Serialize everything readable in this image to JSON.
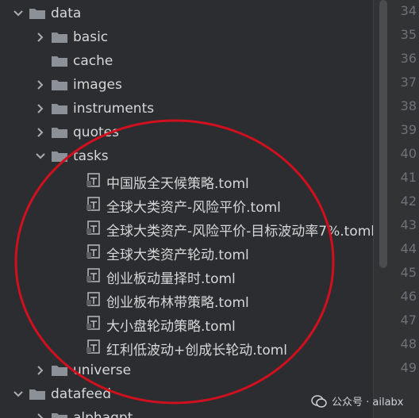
{
  "tree": {
    "rows": [
      {
        "type": "folder",
        "label": "data",
        "expanded": true,
        "depth": 0
      },
      {
        "type": "folder",
        "label": "basic",
        "expanded": false,
        "depth": 1
      },
      {
        "type": "folder",
        "label": "cache",
        "expanded": null,
        "depth": 1
      },
      {
        "type": "folder",
        "label": "images",
        "expanded": false,
        "depth": 1
      },
      {
        "type": "folder",
        "label": "instruments",
        "expanded": false,
        "depth": 1
      },
      {
        "type": "folder",
        "label": "quotes",
        "expanded": false,
        "depth": 1
      },
      {
        "type": "folder",
        "label": "tasks",
        "expanded": true,
        "depth": 1
      },
      {
        "type": "file",
        "label": "中国版全天候策略.toml",
        "depth": 2
      },
      {
        "type": "file",
        "label": "全球大类资产-风险平价.toml",
        "depth": 2
      },
      {
        "type": "file",
        "label": "全球大类资产-风险平价-目标波动率7%.toml",
        "depth": 2
      },
      {
        "type": "file",
        "label": "全球大类资产轮动.toml",
        "depth": 2
      },
      {
        "type": "file",
        "label": "创业板动量择时.toml",
        "depth": 2
      },
      {
        "type": "file",
        "label": "创业板布林带策略.toml",
        "depth": 2
      },
      {
        "type": "file",
        "label": "大小盘轮动策略.toml",
        "depth": 2
      },
      {
        "type": "file",
        "label": "红利低波动+创成长轮动.toml",
        "depth": 2
      },
      {
        "type": "folder",
        "label": "universe",
        "expanded": false,
        "depth": 1
      },
      {
        "type": "folder",
        "label": "datafeed",
        "expanded": true,
        "depth": 0
      },
      {
        "type": "folder",
        "label": "alphagpt",
        "expanded": false,
        "depth": 1
      }
    ]
  },
  "gutter": {
    "line_numbers": [
      "34",
      "35",
      "36",
      "37",
      "38",
      "39",
      "40",
      "41",
      "42",
      "43",
      "44",
      "45",
      "46",
      "47",
      "48",
      "49"
    ]
  },
  "watermark": {
    "text": "公众号 · ailabx"
  },
  "colors": {
    "folder": "#8c9097",
    "annotation": "#d0101e",
    "background": "#2b2d30"
  },
  "icons": {
    "folder": "folder-icon",
    "file": "toml-file-icon",
    "expand": "chevron-down-icon",
    "collapse": "chevron-right-icon"
  }
}
